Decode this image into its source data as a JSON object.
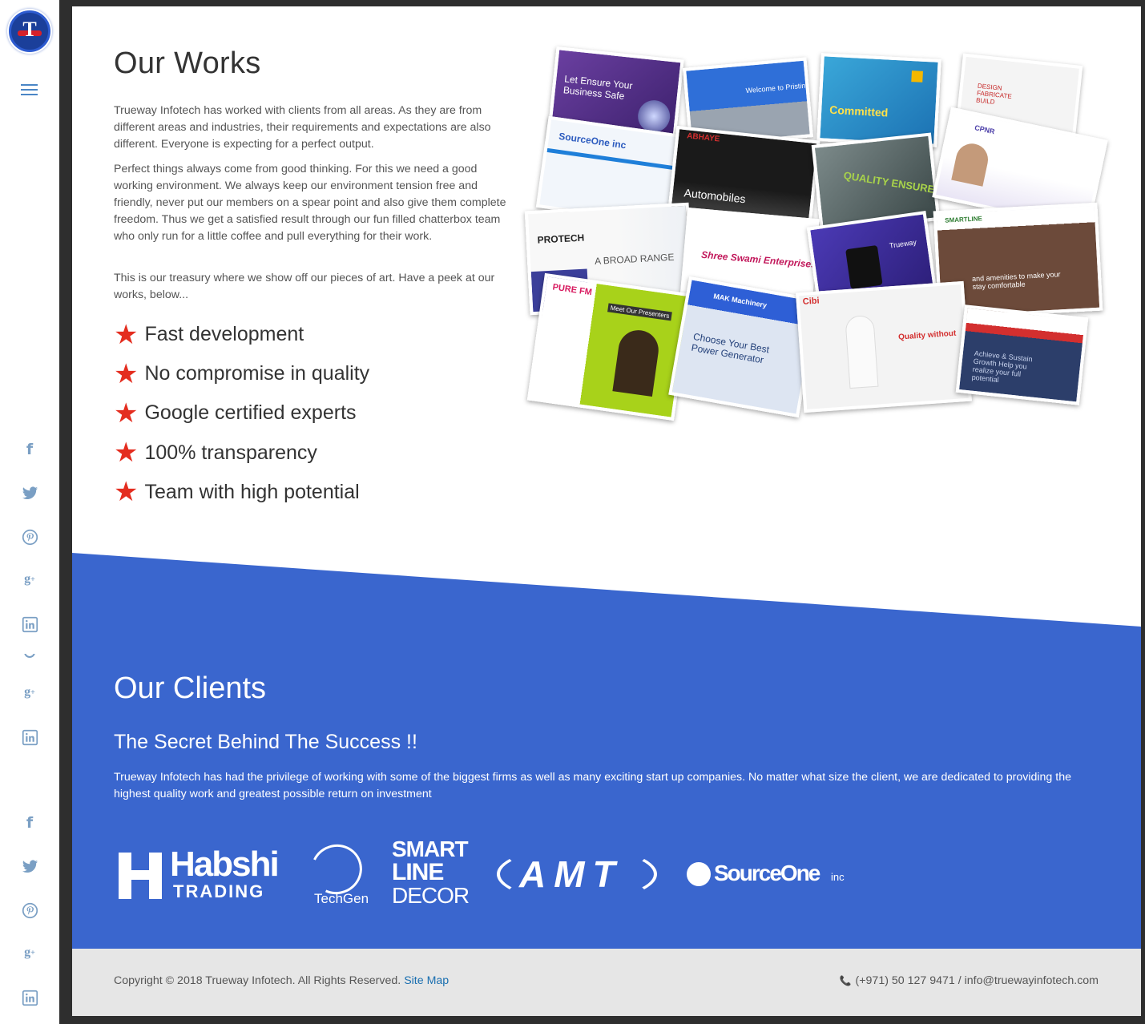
{
  "sidebar": {
    "logo_letter": "T",
    "social_icons": [
      "facebook-icon",
      "twitter-icon",
      "pinterest-icon",
      "google-plus-icon",
      "linkedin-icon"
    ]
  },
  "works": {
    "title": "Our Works",
    "paragraphs": [
      "Trueway Infotech has worked with clients from all areas. As they are from different areas and industries, their requirements and expectations are also different. Everyone is expecting for a perfect output.",
      "Perfect things always come from good thinking. For this we need a good working environment. We always keep our environment tension free and friendly, never put our members on a spear point and also give them complete freedom. Thus we get a satisfied result through our fun filled chatterbox team who only run for a little coffee and pull everything for their work.",
      "This is our treasury where we show off our pieces of art. Have a peek at our works, below..."
    ],
    "features": [
      "Fast development",
      "No compromise in quality",
      "Google certified experts",
      "100% transparency",
      "Team with high potential"
    ],
    "collage": {
      "amt": "Let Ensure Your Business Safe",
      "pristine": "Welcome to Pristine",
      "habshi": "Committed",
      "azbb": "DESIGN FABRICATE BUILD",
      "sourceone": "SourceOne inc",
      "abhaye": "ABHAYE",
      "automobiles": "Automobiles",
      "quality": "QUALITY ENSURED",
      "cpnr": "CPNR",
      "protech": "PROTECH",
      "broad_range": "A BROAD RANGE",
      "ssr": "Shree Swami Enterprises",
      "trueway": "Trueway",
      "smartline": "SMARTLINE",
      "hotel": "and amenities to make your stay comfortable",
      "purefm": "PURE FM",
      "presenters": "Meet Our Presenters",
      "mak": "MAK Machinery",
      "generator": "Choose Your Best Power Generator",
      "cibi": "Cibi",
      "quality_without": "Quality without",
      "achieve": "Achieve & Sustain Growth Help you realize your full potential"
    }
  },
  "clients": {
    "title": "Our Clients",
    "subtitle": "The Secret Behind The Success !!",
    "description": "Trueway Infotech has had the privilege of working with some of the biggest firms as well as many exciting start up companies. No matter what size the client, we are dedicated to providing the highest quality work and greatest possible return on investment",
    "logos": {
      "habshi_top": "Habshi",
      "habshi_bottom": "TRADING",
      "techgen": "TechGen",
      "smartline_1": "SMART",
      "smartline_2": "LINE",
      "smartline_3": "DECOR",
      "amt": "AMT",
      "sourceone": "SourceOne",
      "sourceone_suffix": "inc"
    }
  },
  "footer": {
    "copyright": "Copyright © 2018 Trueway Infotech. All Rights Reserved.",
    "sitemap": "Site Map",
    "contact": "(+971) 50 127 9471 / info@truewayinfotech.com"
  },
  "colors": {
    "accent_blue": "#3a66ce",
    "star_red": "#e42d1f",
    "link_blue": "#1a6fb0",
    "footer_bg": "#e6e6e6"
  }
}
